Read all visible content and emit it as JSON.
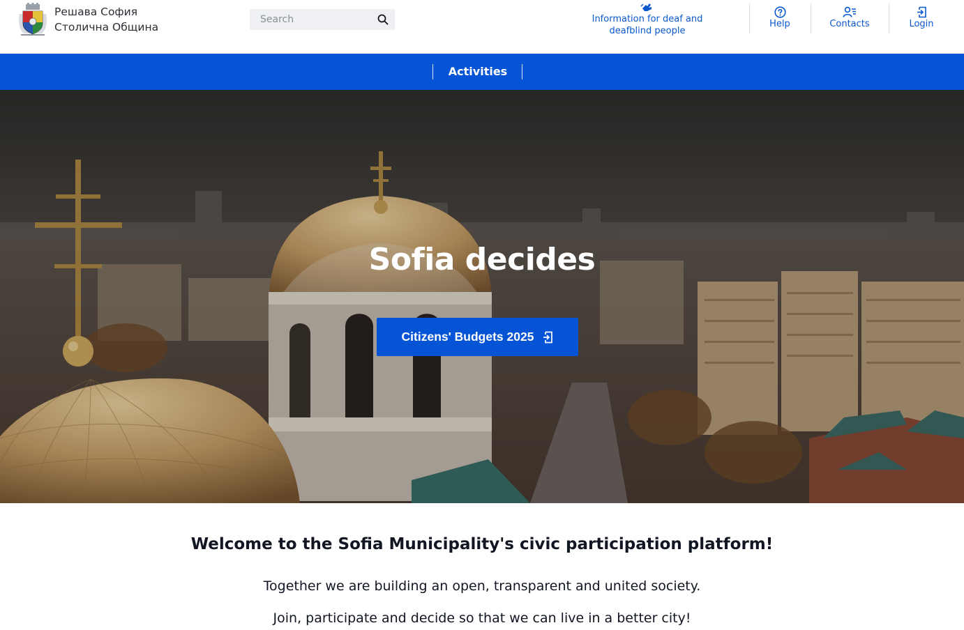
{
  "header": {
    "logo_line1": "Решава София",
    "logo_line2": "Столична Община",
    "search_placeholder": "Search",
    "deaf_info": "Information for deaf and deafblind people",
    "help": "Help",
    "contacts": "Contacts",
    "login": "Login"
  },
  "nav": {
    "activities": "Activities"
  },
  "hero": {
    "title": "Sofia decides",
    "button": "Citizens' Budgets 2025"
  },
  "intro": {
    "welcome": "Welcome to the Sofia Municipality's civic participation platform!",
    "line1": "Together we are building an open, transparent and united society.",
    "line2": "Join, participate and decide so that we can live in a better city!"
  },
  "colors": {
    "brand_blue": "#0654d6",
    "link_blue": "#0a58d0"
  },
  "icons": [
    "coat-of-arms-logo",
    "search-icon",
    "sign-language-icon",
    "help-icon",
    "contacts-icon",
    "login-icon"
  ]
}
